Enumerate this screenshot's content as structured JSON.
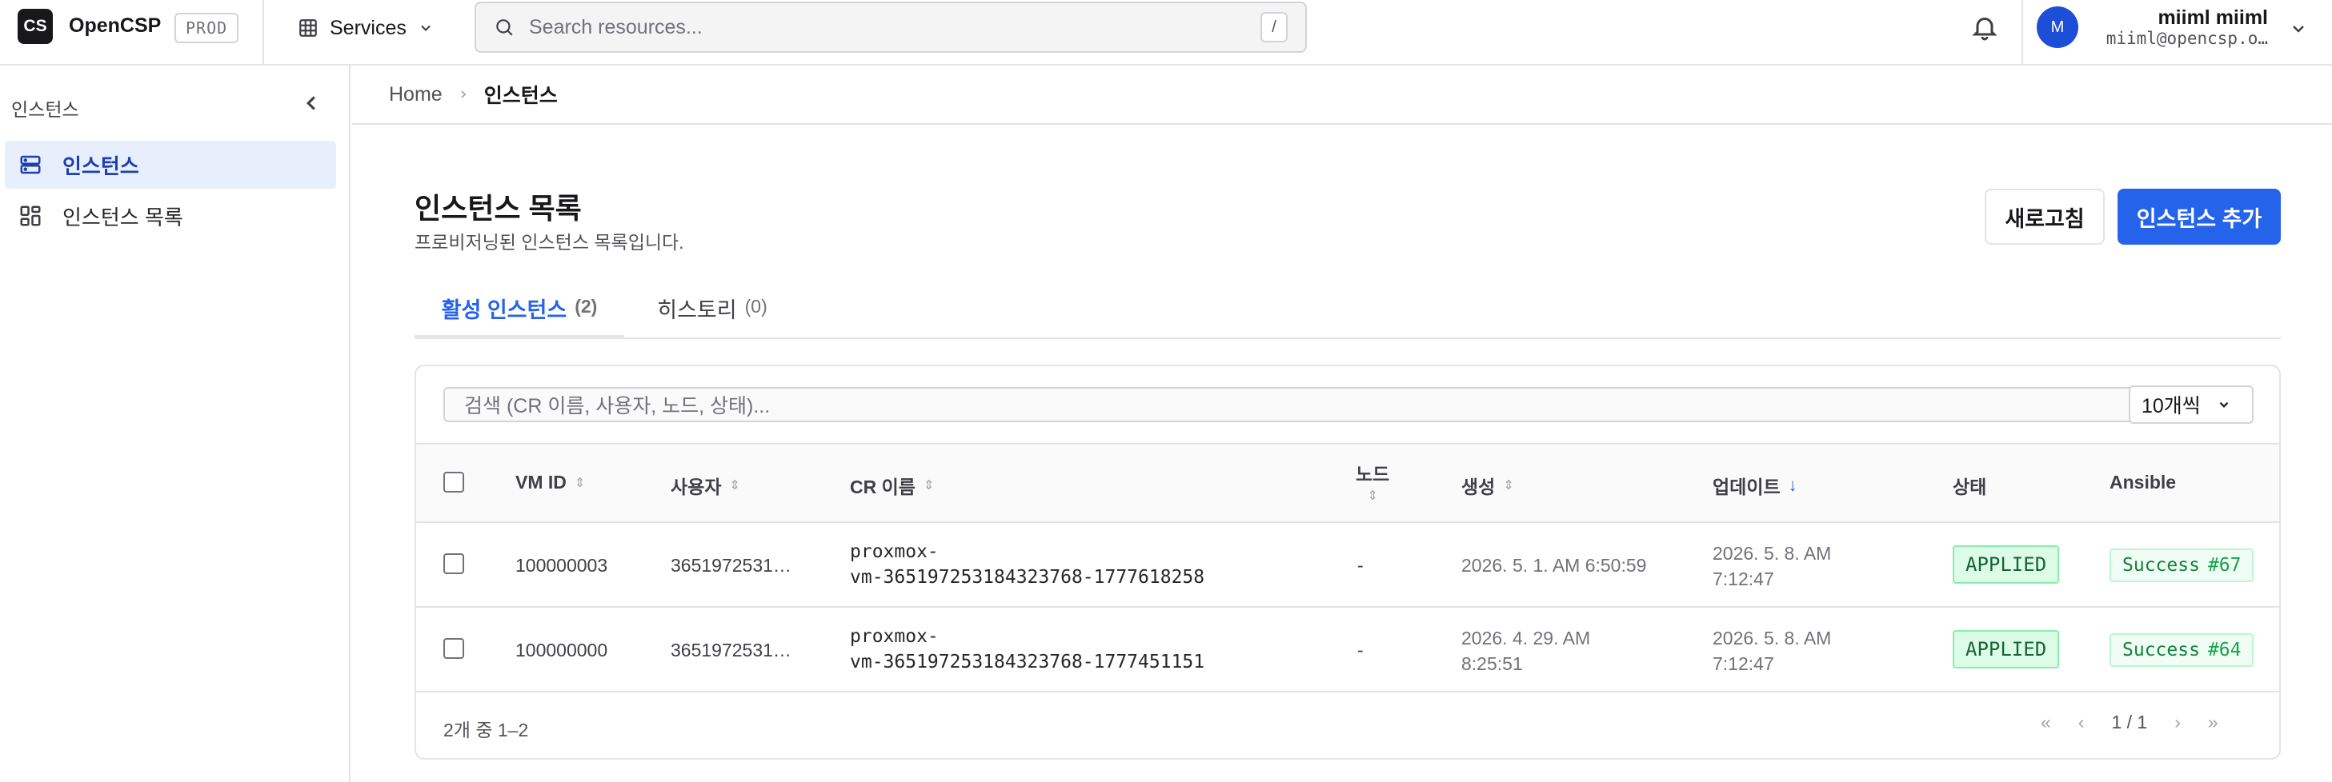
{
  "header": {
    "logo_text": "CS",
    "brand": "OpenCSP",
    "env": "PROD",
    "services_label": "Services",
    "search_placeholder": "Search resources...",
    "search_shortcut": "/",
    "user_avatar": "M",
    "user_name": "miiml miiml",
    "user_email": "miiml@opencsp.o…"
  },
  "sidebar": {
    "title": "인스턴스",
    "items": [
      {
        "label": "인스턴스",
        "icon": "server-icon",
        "active": true
      },
      {
        "label": "인스턴스 목록",
        "icon": "grid-icon",
        "active": false
      }
    ]
  },
  "breadcrumb": {
    "home": "Home",
    "current": "인스턴스"
  },
  "page": {
    "title": "인스턴스 목록",
    "subtitle": "프로비저닝된 인스턴스 목록입니다.",
    "refresh_label": "새로고침",
    "add_label": "인스턴스 추가"
  },
  "tabs": [
    {
      "label": "활성 인스턴스",
      "count": "(2)",
      "active": true
    },
    {
      "label": "히스토리",
      "count": "(0)",
      "active": false
    }
  ],
  "table": {
    "filter_placeholder": "검색 (CR 이름, 사용자, 노드, 상태)...",
    "page_size": "10개씩",
    "columns": [
      "VM ID",
      "사용자",
      "CR 이름",
      "노드",
      "생성",
      "업데이트",
      "상태",
      "Ansible"
    ],
    "rows": [
      {
        "vm_id": "100000003",
        "user": "3651972531…",
        "cr_line1": "proxmox-",
        "cr_line2": "vm-365197253184323768-1777618258",
        "node": "-",
        "created_line1": "2026. 5. 1. AM 6:50:59",
        "created_line2": "",
        "updated_line1": "2026. 5. 8. AM",
        "updated_line2": "7:12:47",
        "status": "APPLIED",
        "ansible_label": "Success",
        "ansible_num": "#67"
      },
      {
        "vm_id": "100000000",
        "user": "3651972531…",
        "cr_line1": "proxmox-",
        "cr_line2": "vm-365197253184323768-1777451151",
        "node": "-",
        "created_line1": "2026. 4. 29. AM",
        "created_line2": "8:25:51",
        "updated_line1": "2026. 5. 8. AM",
        "updated_line2": "7:12:47",
        "status": "APPLIED",
        "ansible_label": "Success",
        "ansible_num": "#64"
      }
    ],
    "footer_summary": "2개 중 1–2",
    "pager": {
      "first": "«",
      "prev": "‹",
      "page": "1 / 1",
      "next": "›",
      "last": "»"
    }
  },
  "colors": {
    "primary": "#2563eb",
    "status_applied": "#166534",
    "ansible_success": "#15803d"
  }
}
